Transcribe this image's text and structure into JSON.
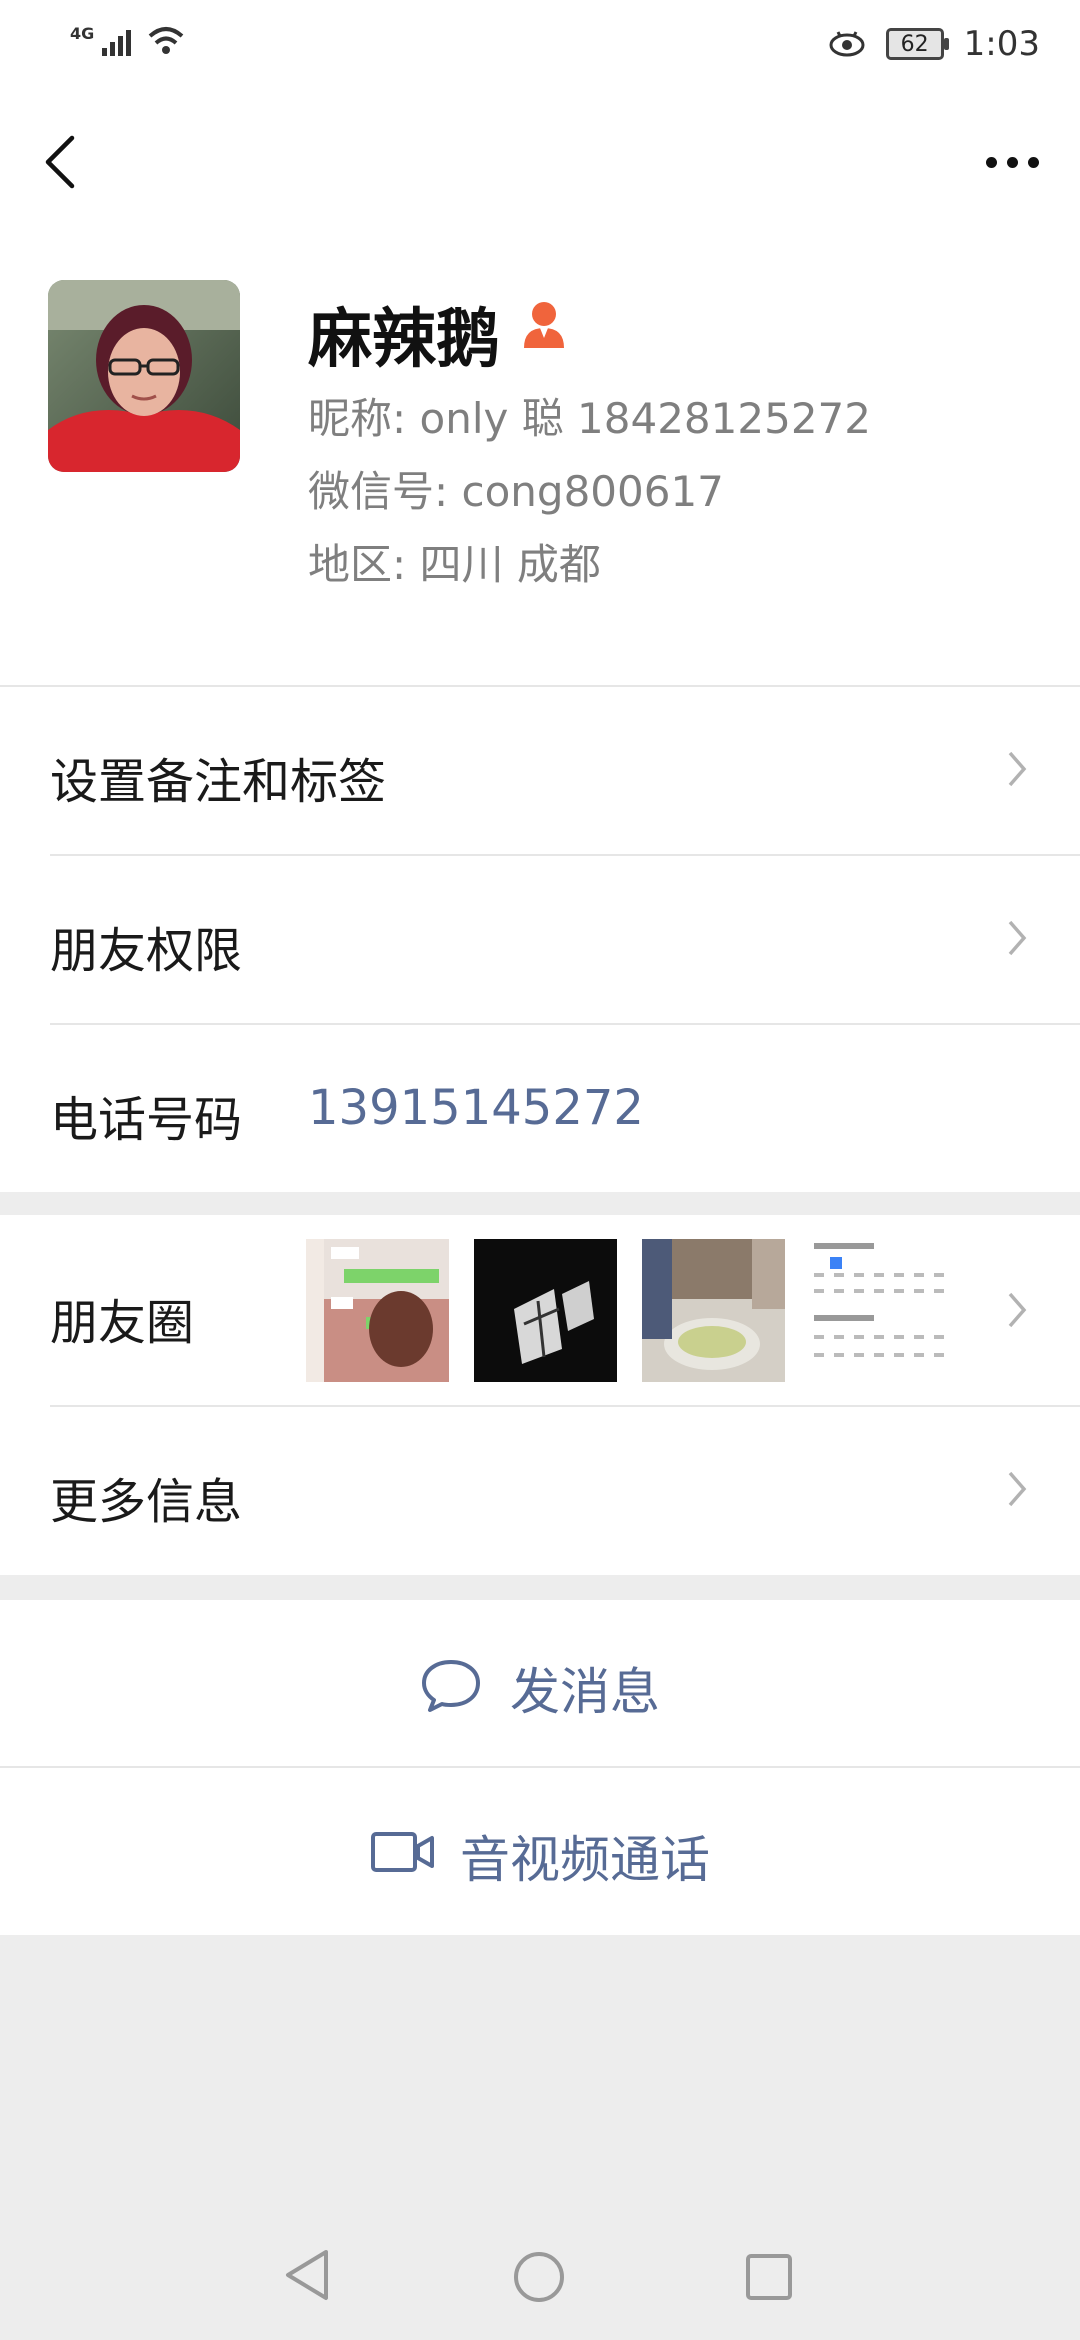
{
  "status_bar": {
    "network": "4G",
    "battery": "62",
    "time": "1:03"
  },
  "profile": {
    "name": "麻辣鹅",
    "nickname": "昵称: only 聪 18428125272",
    "wechat_id": "微信号: cong800617",
    "region": "地区: 四川 成都"
  },
  "menu": {
    "remark_tags": "设置备注和标签",
    "friend_permissions": "朋友权限",
    "phone_label": "电话号码",
    "phone_value": "13915145272",
    "moments": "朋友圈",
    "more_info": "更多信息"
  },
  "actions": {
    "send_message": "发消息",
    "av_call": "音视频通话"
  },
  "colors": {
    "link": "#576b95",
    "background": "#ededed",
    "accent_person_icon": "#f0643c"
  }
}
